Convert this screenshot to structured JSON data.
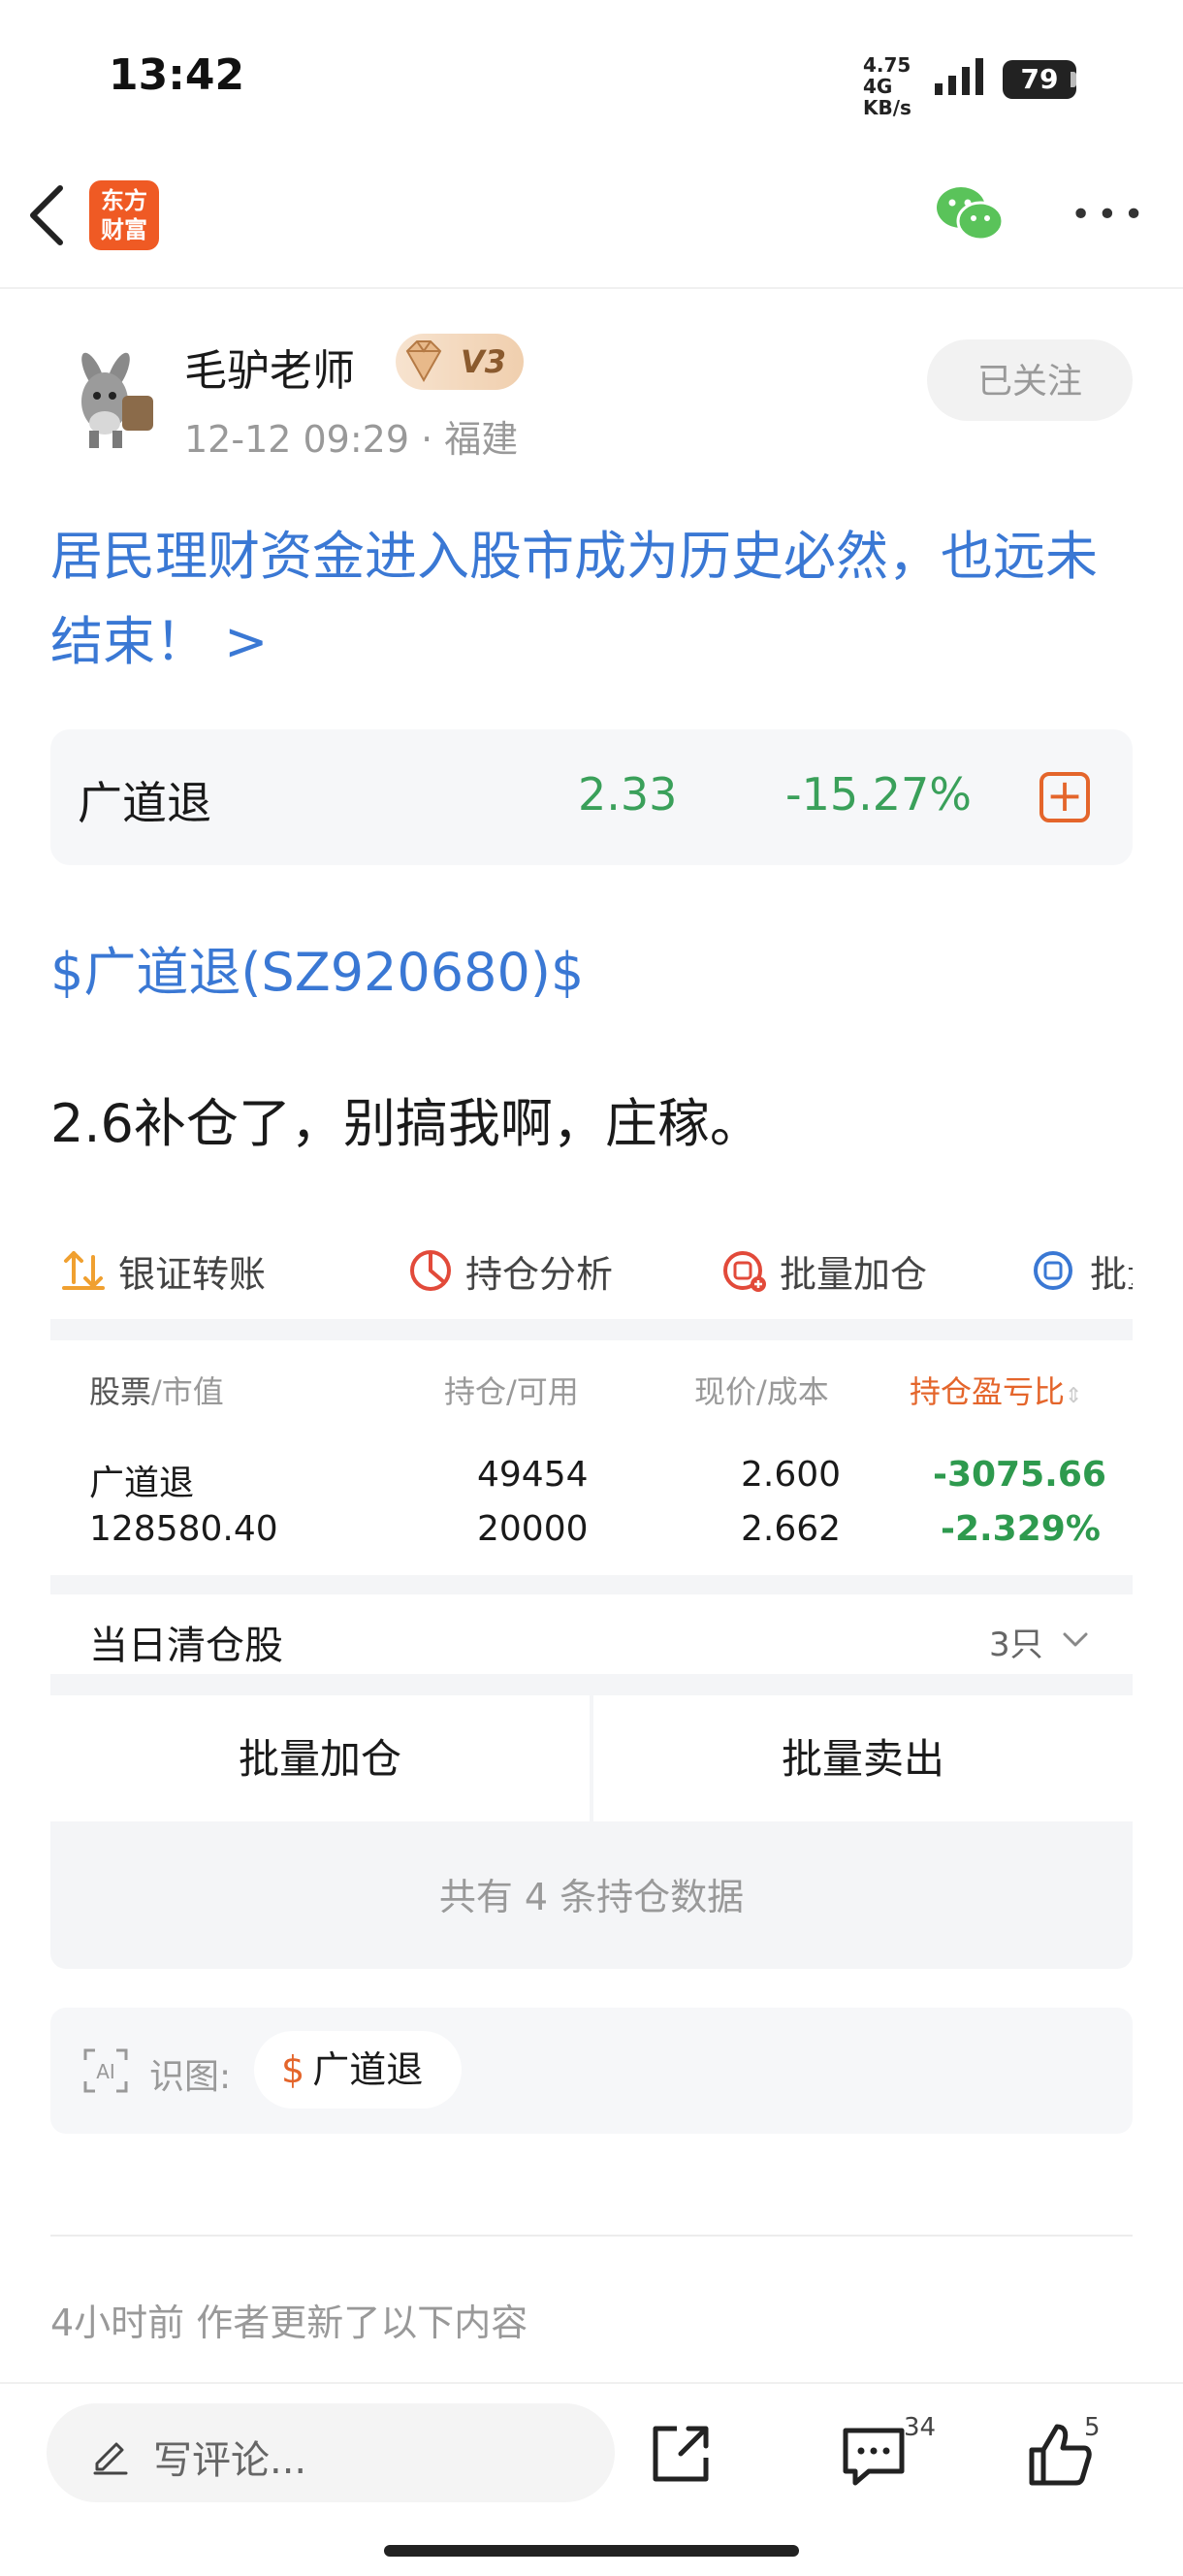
{
  "status_bar": {
    "time": "13:42",
    "net_speed": "4.75",
    "net_unit": "KB/s",
    "net_type": "4G",
    "battery": "79"
  },
  "nav": {
    "logo_line1": "东方",
    "logo_line2": "财富"
  },
  "author": {
    "name": "毛驴老师",
    "level": "V3",
    "time": "12-12 09:29",
    "location": "· 福建",
    "follow_label": "已关注"
  },
  "post": {
    "title": "居民理财资金进入股市成为历史必然，也远未结束！ >",
    "stock_link": "$广道退(SZ920680)$",
    "body": "2.6补仓了，别搞我啊，庄稼。"
  },
  "quote": {
    "name": "广道退",
    "price": "2.33",
    "change": "-15.27%",
    "add_symbol": "+"
  },
  "holdings": {
    "tabs": [
      {
        "label": "银证转账"
      },
      {
        "label": "持仓分析"
      },
      {
        "label": "批量加仓"
      },
      {
        "label": "批量"
      }
    ],
    "headers": {
      "col1_a": "股票",
      "col1_b": "/市值",
      "col2_a": "持仓",
      "col2_b": "/可用",
      "col3_a": "现价",
      "col3_b": "/成本",
      "col4": "持仓盈亏比"
    },
    "rows": [
      {
        "name": "广道退",
        "market_value": "128580.40",
        "position": "49454",
        "available": "20000",
        "price": "2.600",
        "cost": "2.662",
        "pnl": "-3075.66",
        "pnl_ratio": "-2.329%"
      }
    ],
    "cleared_label": "当日清仓股",
    "cleared_count": "3只",
    "batch_add": "批量加仓",
    "batch_sell": "批量卖出",
    "total_note": "共有 4 条持仓数据"
  },
  "ai": {
    "icon_text": "AI",
    "label": "识图:",
    "chip_symbol": "$",
    "chip_label": "广道退"
  },
  "update_note": "4小时前   作者更新了以下内容",
  "bottom_bar": {
    "comment_placeholder": "写评论...",
    "comment_count": "34",
    "like_count": "5"
  },
  "colors": {
    "link_blue": "#3a78d4",
    "down_green": "#3aa05a",
    "accent_orange": "#e4652b"
  }
}
